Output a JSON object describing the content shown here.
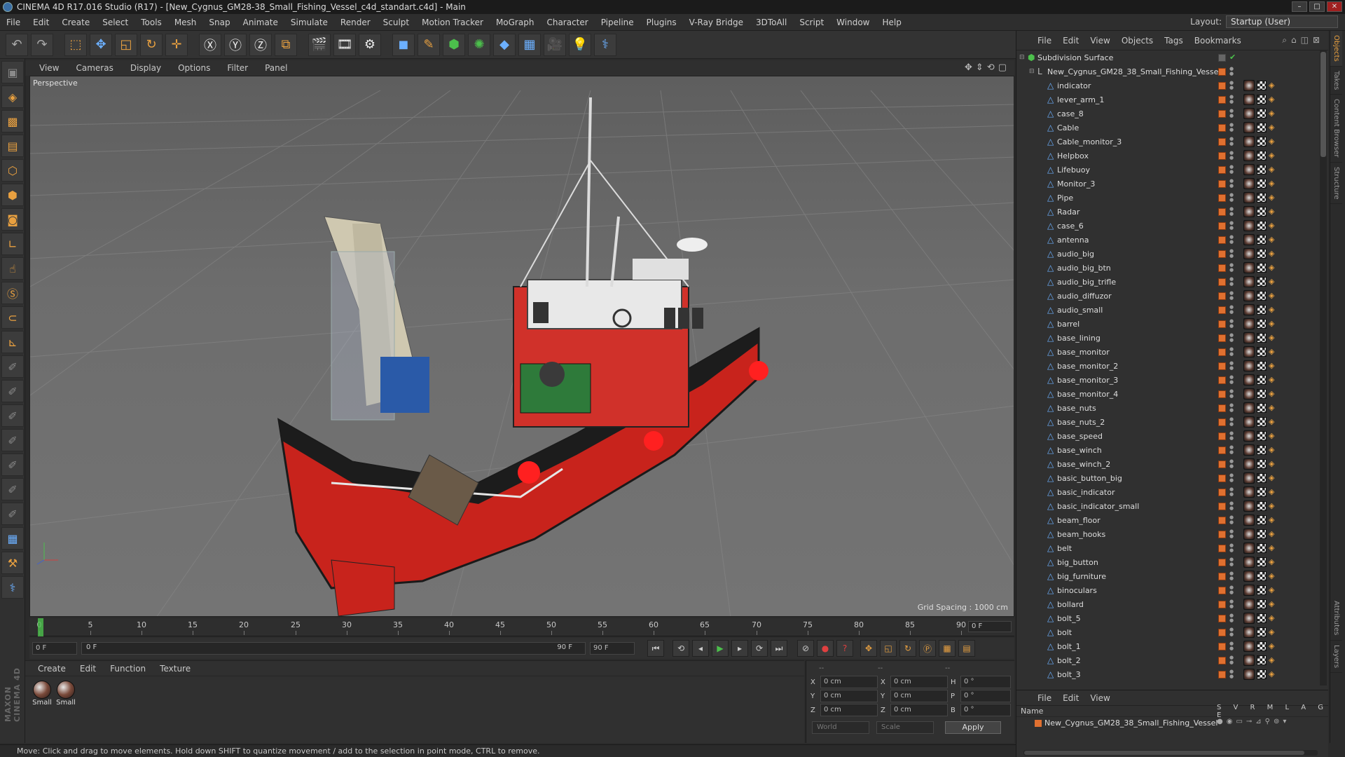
{
  "window": {
    "title": "CINEMA 4D R17.016 Studio (R17) - [New_Cygnus_GM28-38_Small_Fishing_Vessel_c4d_standart.c4d] - Main"
  },
  "menu": [
    "File",
    "Edit",
    "Create",
    "Select",
    "Tools",
    "Mesh",
    "Snap",
    "Animate",
    "Simulate",
    "Render",
    "Sculpt",
    "Motion Tracker",
    "MoGraph",
    "Character",
    "Pipeline",
    "Plugins",
    "V-Ray Bridge",
    "3DToAll",
    "Script",
    "Window",
    "Help"
  ],
  "layout": {
    "label": "Layout:",
    "value": "Startup (User)"
  },
  "viewport": {
    "menu": [
      "View",
      "Cameras",
      "Display",
      "Options",
      "Filter",
      "Panel"
    ],
    "label": "Perspective",
    "grid_spacing": "Grid Spacing : 1000 cm"
  },
  "timeline": {
    "ticks": [
      "0",
      "5",
      "10",
      "15",
      "20",
      "25",
      "30",
      "35",
      "40",
      "45",
      "50",
      "55",
      "60",
      "65",
      "70",
      "75",
      "80",
      "85",
      "90"
    ],
    "current_frame": "0 F"
  },
  "transport": {
    "start": "0 F",
    "range_start": "0 F",
    "range_end": "90 F",
    "end": "90 F"
  },
  "materials": {
    "menu": [
      "Create",
      "Edit",
      "Function",
      "Texture"
    ],
    "items": [
      {
        "label": "Small"
      },
      {
        "label": "Small"
      }
    ]
  },
  "coords": {
    "header": [
      "--",
      "--",
      "--"
    ],
    "rows": [
      {
        "a": "X",
        "av": "0 cm",
        "b": "X",
        "bv": "0 cm",
        "c": "H",
        "cv": "0 °"
      },
      {
        "a": "Y",
        "av": "0 cm",
        "b": "Y",
        "bv": "0 cm",
        "c": "P",
        "cv": "0 °"
      },
      {
        "a": "Z",
        "av": "0 cm",
        "b": "Z",
        "bv": "0 cm",
        "c": "B",
        "cv": "0 °"
      }
    ],
    "mode": "World",
    "scale": "Scale",
    "apply": "Apply"
  },
  "status": "Move: Click and drag to move elements. Hold down SHIFT to quantize movement / add to the selection in point mode, CTRL to remove.",
  "object_manager": {
    "menu": [
      "File",
      "Edit",
      "View",
      "Objects",
      "Tags",
      "Bookmarks"
    ],
    "root": "Subdivision Surface",
    "group": "New_Cygnus_GM28_38_Small_Fishing_Vessel",
    "objects": [
      "indicator",
      "lever_arm_1",
      "case_8",
      "Cable",
      "Cable_monitor_3",
      "Helpbox",
      "Lifebuoy",
      "Monitor_3",
      "Pipe",
      "Radar",
      "case_6",
      "antenna",
      "audio_big",
      "audio_big_btn",
      "audio_big_trifle",
      "audio_diffuzor",
      "audio_small",
      "barrel",
      "base_lining",
      "base_monitor",
      "base_monitor_2",
      "base_monitor_3",
      "base_monitor_4",
      "base_nuts",
      "base_nuts_2",
      "base_speed",
      "base_winch",
      "base_winch_2",
      "basic_button_big",
      "basic_indicator",
      "basic_indicator_small",
      "beam_floor",
      "beam_hooks",
      "belt",
      "big_button",
      "big_furniture",
      "binoculars",
      "bollard",
      "bolt_5",
      "bolt",
      "bolt_1",
      "bolt_2",
      "bolt_3"
    ]
  },
  "layer_manager": {
    "menu": [
      "File",
      "Edit",
      "View"
    ],
    "col_name": "Name",
    "col_flags": "S V R M L A G E",
    "layer": "New_Cygnus_GM28_38_Small_Fishing_Vessel"
  },
  "right_tabs": [
    "Objects",
    "Takes",
    "Content Browser",
    "Structure",
    "Attributes",
    "Layers"
  ],
  "maxon": "MAXON CINEMA 4D"
}
